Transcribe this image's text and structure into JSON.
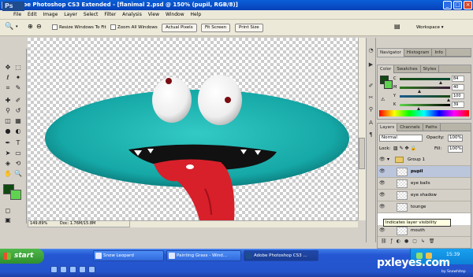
{
  "title": "Adobe Photoshop CS3 Extended - [flanimal 2.psd @ 150% (pupil, RGB/8)]",
  "menus": [
    "File",
    "Edit",
    "Image",
    "Layer",
    "Select",
    "Filter",
    "Analysis",
    "View",
    "Window",
    "Help"
  ],
  "options": {
    "resize_label": "Resize Windows To Fit",
    "zoom_all_label": "Zoom All Windows",
    "actual_pixels": "Actual Pixels",
    "fit_screen": "Fit Screen",
    "print_size": "Print Size",
    "workspace": "Workspace ▾"
  },
  "toolbox": {
    "logo": "Ps"
  },
  "status": {
    "zoom": "149.89%",
    "doc": "Doc: 1.76M/15.8M"
  },
  "navigator": {
    "tabs": [
      "Navigator",
      "Histogram",
      "Info"
    ]
  },
  "color_panel": {
    "tabs": [
      "Color",
      "Swatches",
      "Styles"
    ],
    "channels": [
      {
        "label": "C",
        "value": "84",
        "fraction": 0.84
      },
      {
        "label": "M",
        "value": "40",
        "fraction": 0.4
      },
      {
        "label": "Y",
        "value": "100",
        "fraction": 1.0
      },
      {
        "label": "K",
        "value": "39",
        "fraction": 0.39
      }
    ],
    "fg_color": "#104a12",
    "bg_color": "#5fd34f"
  },
  "layers_panel": {
    "tabs": [
      "Layers",
      "Channels",
      "Paths"
    ],
    "blend_mode": "Normal",
    "opacity_label": "Opacity:",
    "opacity_value": "100%",
    "lock_label": "Lock:",
    "fill_label": "Fill:",
    "fill_value": "100%",
    "layers": [
      {
        "name": "Group 1",
        "selected": false
      },
      {
        "name": "pupil",
        "selected": true
      },
      {
        "name": "eye balls",
        "selected": false
      },
      {
        "name": "eye shadow",
        "selected": false
      },
      {
        "name": "tounge",
        "selected": false
      },
      {
        "name": "mouth",
        "selected": false
      }
    ],
    "tooltip": "Indicates layer visibility"
  },
  "taskbar": {
    "start": "start",
    "items": [
      "Snow Leopard",
      "Painting Grass - Wind...",
      "Adobe Photoshop CS3 ..."
    ],
    "clock": "15:39"
  },
  "watermark": "pxleyes.com",
  "watermark_site": "by Snowhitep"
}
